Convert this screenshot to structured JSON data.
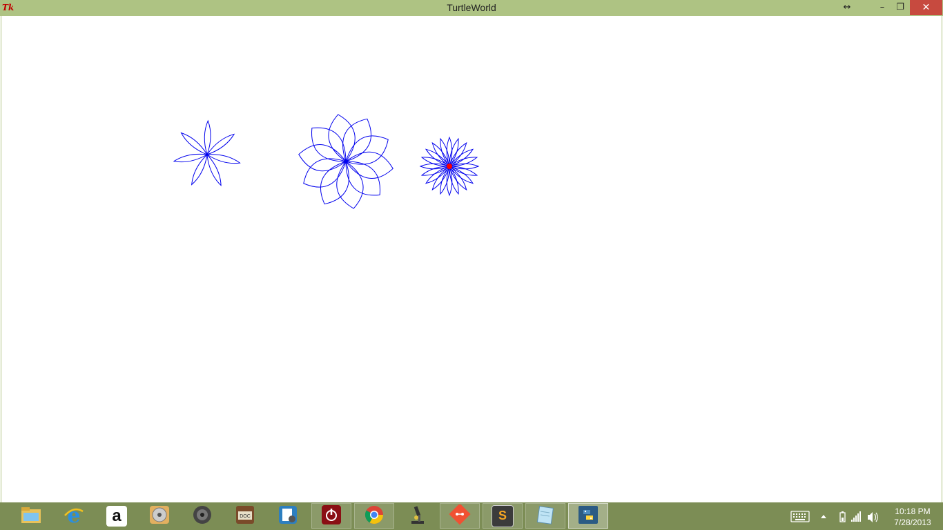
{
  "window": {
    "title": "TurtleWorld",
    "app_icon_text": "Tk",
    "controls": {
      "resize_glyph": "↔",
      "minimize_glyph": "–",
      "restore_glyph": "❐",
      "close_glyph": "✕"
    }
  },
  "canvas": {
    "background": "#ffffff",
    "stroke_color": "#0000ee",
    "turtle_color": "#ff0000",
    "flowers": [
      {
        "petals": 7,
        "shape": "narrow"
      },
      {
        "petals": 10,
        "shape": "wide"
      },
      {
        "petals": 20,
        "shape": "narrow"
      }
    ]
  },
  "taskbar": {
    "items": [
      {
        "name": "file-explorer",
        "icon": "folder-icon",
        "running": false
      },
      {
        "name": "internet-explorer",
        "icon": "ie-icon",
        "running": false
      },
      {
        "name": "amazon",
        "icon": "amazon-icon",
        "running": false
      },
      {
        "name": "disc-utility",
        "icon": "disc-icon",
        "running": false
      },
      {
        "name": "speaker-app",
        "icon": "speaker-icon",
        "running": false
      },
      {
        "name": "document-app",
        "icon": "doc-icon",
        "running": false
      },
      {
        "name": "settings-doc",
        "icon": "settings-doc-icon",
        "running": false
      },
      {
        "name": "power-app",
        "icon": "power-icon",
        "running": true
      },
      {
        "name": "chrome",
        "icon": "chrome-icon",
        "running": true
      },
      {
        "name": "microscope-app",
        "icon": "microscope-icon",
        "running": false
      },
      {
        "name": "git",
        "icon": "git-icon",
        "running": true
      },
      {
        "name": "sublime-text",
        "icon": "sublime-icon",
        "running": true
      },
      {
        "name": "notepad",
        "icon": "notepad-icon",
        "running": true
      },
      {
        "name": "python",
        "icon": "python-icon",
        "running": true,
        "active": true
      }
    ],
    "amazon_letter": "a",
    "sublime_letter": "S",
    "doc_label": "DOC",
    "clock": {
      "time": "10:18 PM",
      "date": "7/28/2013"
    }
  }
}
